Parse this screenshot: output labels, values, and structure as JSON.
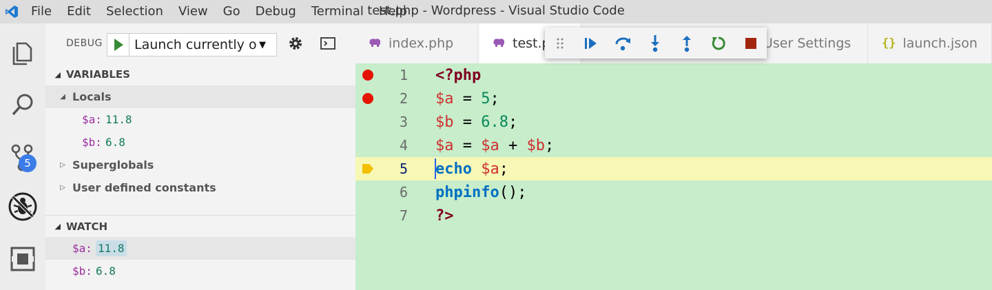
{
  "titlebar": {
    "menu": [
      "File",
      "Edit",
      "Selection",
      "View",
      "Go",
      "Debug",
      "Terminal",
      "Help"
    ],
    "window_title": "test.php - Wordpress - Visual Studio Code"
  },
  "activity_bar": {
    "items": [
      "explorer-icon",
      "search-icon",
      "source-control-icon",
      "debug-icon",
      "extensions-icon"
    ],
    "scm_badge": "5"
  },
  "debug_toolbar": {
    "label": "DEBUG",
    "launch_config": "Launch currently ope",
    "caret": "▼"
  },
  "variables": {
    "header": "VARIABLES",
    "locals_label": "Locals",
    "locals": [
      {
        "name": "$a:",
        "value": "11.8"
      },
      {
        "name": "$b:",
        "value": "6.8"
      }
    ],
    "superglobals_label": "Superglobals",
    "constants_label": "User defined constants"
  },
  "watch": {
    "header": "WATCH",
    "items": [
      {
        "name": "$a:",
        "value": "11.8"
      },
      {
        "name": "$b:",
        "value": "6.8"
      }
    ]
  },
  "tabs": [
    {
      "label": "index.php",
      "icon": "php-elephant-icon"
    },
    {
      "label": "test.p",
      "icon": "php-elephant-icon",
      "active": true
    },
    {
      "label": "User Settings",
      "icon": ""
    },
    {
      "label": "launch.json",
      "icon": "json-braces-icon"
    }
  ],
  "editor": {
    "lines": [
      {
        "number": "1",
        "breakpoint": true
      },
      {
        "number": "2",
        "breakpoint": true
      },
      {
        "number": "3",
        "breakpoint": false
      },
      {
        "number": "4",
        "breakpoint": false
      },
      {
        "number": "5",
        "current": true
      },
      {
        "number": "6",
        "breakpoint": false
      },
      {
        "number": "7",
        "breakpoint": false
      }
    ],
    "code": {
      "l1_tag": "<?php",
      "l2_var": "$a",
      "l2_op": " = ",
      "l2_num": "5",
      "l2_end": ";",
      "l3_var": "$b",
      "l3_op": " = ",
      "l3_num": "6.8",
      "l3_end": ";",
      "l4_var1": "$a",
      "l4_op1": " = ",
      "l4_var2": "$a",
      "l4_op2": " + ",
      "l4_var3": "$b",
      "l4_end": ";",
      "l5_kw": "echo",
      "l5_sp": " ",
      "l5_var": "$a",
      "l5_end": ";",
      "l6_fn": "phpinfo",
      "l6_end": "();",
      "l7_tag": "?>"
    }
  },
  "colors": {
    "editor_bg": "#c7edcb",
    "current_line": "#f7f7b6",
    "breakpoint": "#e51400",
    "stop": "#a1260d",
    "continue": "#1a6fbf",
    "restart": "#388a34"
  }
}
